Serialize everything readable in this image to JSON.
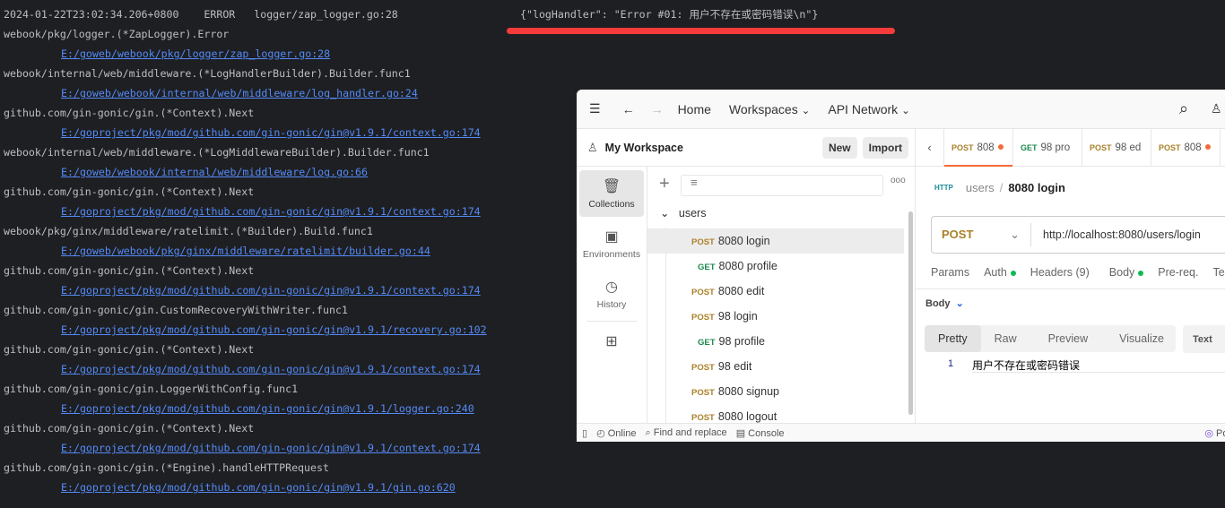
{
  "terminal": {
    "header": {
      "timestamp": "2024-01-22T23:02:34.206+0800",
      "level": "ERROR",
      "caller": "logger/zap_logger.go:28",
      "message": "{\"logHandler\": \"Error #01: 用户不存在或密码错误\\n\"}"
    },
    "lines": [
      {
        "text": "webook/pkg/logger.(*ZapLogger).Error",
        "link": false
      },
      {
        "text": "E:/goweb/webook/pkg/logger/zap_logger.go:28",
        "link": true
      },
      {
        "text": "webook/internal/web/middleware.(*LogHandlerBuilder).Builder.func1",
        "link": false
      },
      {
        "text": "E:/goweb/webook/internal/web/middleware/log_handler.go:24",
        "link": true
      },
      {
        "text": "github.com/gin-gonic/gin.(*Context).Next",
        "link": false
      },
      {
        "text": "E:/goproject/pkg/mod/github.com/gin-gonic/gin@v1.9.1/context.go:174",
        "link": true
      },
      {
        "text": "webook/internal/web/middleware.(*LogMiddlewareBuilder).Builder.func1",
        "link": false
      },
      {
        "text": "E:/goweb/webook/internal/web/middleware/log.go:66",
        "link": true
      },
      {
        "text": "github.com/gin-gonic/gin.(*Context).Next",
        "link": false
      },
      {
        "text": "E:/goproject/pkg/mod/github.com/gin-gonic/gin@v1.9.1/context.go:174",
        "link": true
      },
      {
        "text": "webook/pkg/ginx/middleware/ratelimit.(*Builder).Build.func1",
        "link": false
      },
      {
        "text": "E:/goweb/webook/pkg/ginx/middleware/ratelimit/builder.go:44",
        "link": true
      },
      {
        "text": "github.com/gin-gonic/gin.(*Context).Next",
        "link": false
      },
      {
        "text": "E:/goproject/pkg/mod/github.com/gin-gonic/gin@v1.9.1/context.go:174",
        "link": true
      },
      {
        "text": "github.com/gin-gonic/gin.CustomRecoveryWithWriter.func1",
        "link": false
      },
      {
        "text": "E:/goproject/pkg/mod/github.com/gin-gonic/gin@v1.9.1/recovery.go:102",
        "link": true
      },
      {
        "text": "github.com/gin-gonic/gin.(*Context).Next",
        "link": false
      },
      {
        "text": "E:/goproject/pkg/mod/github.com/gin-gonic/gin@v1.9.1/context.go:174",
        "link": true
      },
      {
        "text": "github.com/gin-gonic/gin.LoggerWithConfig.func1",
        "link": false
      },
      {
        "text": "E:/goproject/pkg/mod/github.com/gin-gonic/gin@v1.9.1/logger.go:240",
        "link": true
      },
      {
        "text": "github.com/gin-gonic/gin.(*Context).Next",
        "link": false
      },
      {
        "text": "E:/goproject/pkg/mod/github.com/gin-gonic/gin@v1.9.1/context.go:174",
        "link": true
      },
      {
        "text": "github.com/gin-gonic/gin.(*Engine).handleHTTPRequest",
        "link": false
      },
      {
        "text": "E:/goproject/pkg/mod/github.com/gin-gonic/gin@v1.9.1/gin.go:620",
        "link": true
      }
    ]
  },
  "postman": {
    "nav": {
      "home": "Home",
      "workspaces": "Workspaces",
      "api_network": "API Network"
    },
    "workspace": {
      "name": "My Workspace",
      "new": "New",
      "import": "Import"
    },
    "rail": [
      "Collections",
      "Environments",
      "History"
    ],
    "collection": {
      "name": "users",
      "items": [
        {
          "method": "POST",
          "name": "8080 login"
        },
        {
          "method": "GET",
          "name": "8080 profile"
        },
        {
          "method": "POST",
          "name": "8080 edit"
        },
        {
          "method": "POST",
          "name": "98 login"
        },
        {
          "method": "GET",
          "name": "98 profile"
        },
        {
          "method": "POST",
          "name": "98 edit"
        },
        {
          "method": "POST",
          "name": "8080 signup"
        },
        {
          "method": "POST",
          "name": "8080 logout"
        }
      ]
    },
    "tabs": [
      {
        "method": "POST",
        "name": "808",
        "dot": true
      },
      {
        "method": "GET",
        "name": "98 pro",
        "dot": false
      },
      {
        "method": "POST",
        "name": "98 ed",
        "dot": false
      },
      {
        "method": "POST",
        "name": "808",
        "dot": true
      }
    ],
    "breadcrumb": {
      "parent": "users",
      "current": "8080 login"
    },
    "request": {
      "method": "POST",
      "url": "http://localhost:8080/users/login"
    },
    "req_tabs": [
      "Params",
      "Auth",
      "Headers (9)",
      "Body",
      "Pre-req.",
      "Te"
    ],
    "response": {
      "label": "Body",
      "views": [
        "Pretty",
        "Raw",
        "Preview",
        "Visualize"
      ],
      "format": "Text",
      "line_no": "1",
      "body": "用户不存在或密码错误"
    },
    "footer": {
      "online": "Online",
      "find": "Find and replace",
      "console": "Console",
      "post": "Post"
    },
    "colors": {
      "post": "#a9812a",
      "get": "#1d8a4d",
      "accent": "#f26b3a"
    }
  }
}
